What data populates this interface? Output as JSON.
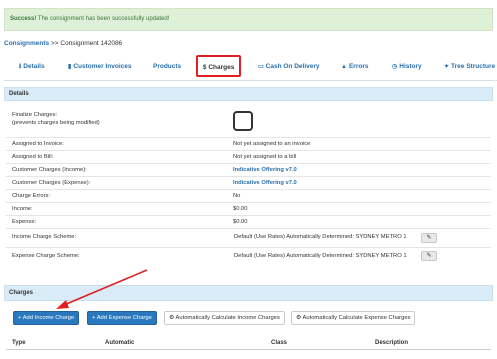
{
  "alert": {
    "strong": "Success!",
    "text": " The consignment has been successfully updated!"
  },
  "breadcrumb": {
    "parent": "Consignments",
    "sep": " >> ",
    "current": "Consignment 142086"
  },
  "tabs": [
    {
      "label": "Details",
      "icon": "info-icon"
    },
    {
      "label": "Customer Invoices",
      "icon": "file-icon"
    },
    {
      "label": "Products",
      "icon": ""
    },
    {
      "label": "Charges",
      "icon": "dollar-icon"
    },
    {
      "label": "Cash On Delivery",
      "icon": "money-icon"
    },
    {
      "label": "Errors",
      "icon": "warning-icon"
    },
    {
      "label": "History",
      "icon": "clock-icon"
    },
    {
      "label": "Tree Structure",
      "icon": "pin-icon"
    }
  ],
  "details": {
    "title": "Details",
    "finalize_label_1": "Finalize Charges:",
    "finalize_label_2": "(prevents charges being modified)",
    "rows": [
      {
        "label": "Assigned to Invoice:",
        "value": "Not yet assigned to an invoice"
      },
      {
        "label": "Assigned to Bill:",
        "value": "Not yet assigned to a bill"
      },
      {
        "label": "Customer Charges (Income):",
        "value": "Indicative Offering v7.0"
      },
      {
        "label": "Customer Charges (Expense):",
        "value": "Indicative Offering v7.0"
      },
      {
        "label": "Charge Errors:",
        "value": "No"
      },
      {
        "label": "Income:",
        "value": "$0.00"
      },
      {
        "label": "Expense:",
        "value": "$0.00"
      },
      {
        "label": "Income Charge Scheme:",
        "value": "Default (Use Rates)  Automatically Determined: SYDNEY METRO 1"
      },
      {
        "label": "Expense Charge Scheme:",
        "value": "Default (Use Rates)  Automatically Determined: SYDNEY METRO 1"
      }
    ]
  },
  "charges": {
    "title": "Charges",
    "buttons": {
      "add_income": "Add Income Charge",
      "add_expense": "Add Expense Charge",
      "auto_income": "Automatically Calculate Income Charges",
      "auto_expense": "Automatically Calculate Expense Charges"
    },
    "columns": [
      "Type",
      "Automatic",
      "Class",
      "Description"
    ]
  },
  "colors": {
    "accent": "#2a78bd",
    "highlight": "#e02020",
    "success_bg": "#dff0d8"
  }
}
